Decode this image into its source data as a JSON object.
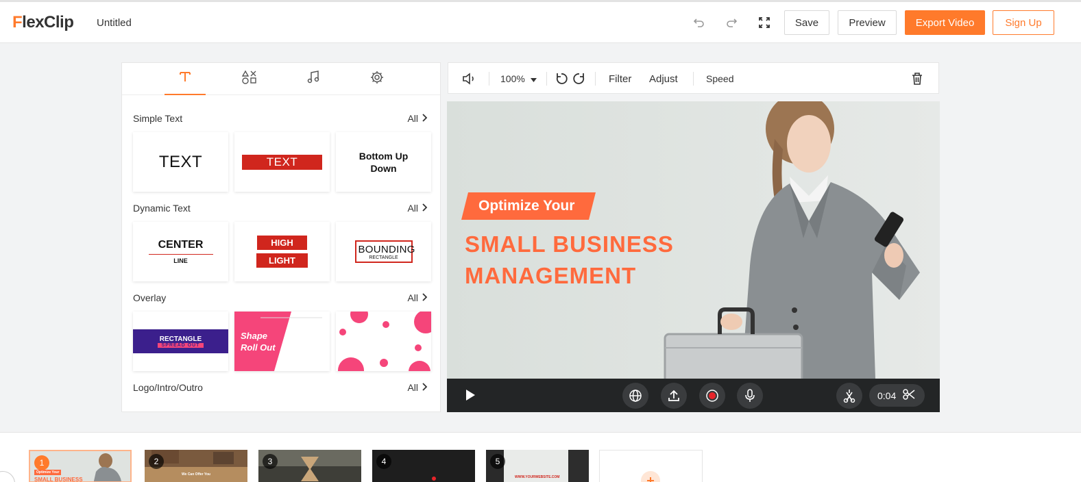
{
  "header": {
    "logo": "FlexClip",
    "doc_title": "Untitled",
    "save_label": "Save",
    "preview_label": "Preview",
    "export_label": "Export Video",
    "signup_label": "Sign Up"
  },
  "panel": {
    "sections": [
      {
        "title": "Simple Text",
        "all": "All"
      },
      {
        "title": "Dynamic Text",
        "all": "All"
      },
      {
        "title": "Overlay",
        "all": "All"
      },
      {
        "title": "Logo/Intro/Outro",
        "all": "All"
      }
    ],
    "cards": {
      "text_plain": "TEXT",
      "text_boxed": "TEXT",
      "bottom_up": "Bottom Up Down",
      "center": "CENTER",
      "line": "LINE",
      "high": "HIGH",
      "light": "LIGHT",
      "bounding": "BOUNDING",
      "rectangle_small": "RECTANGLE",
      "rectangle": "RECTANGLE",
      "spread_out": "SPREAD OUT",
      "shape": "Shape",
      "roll_out": "Roll Out"
    }
  },
  "toolbar": {
    "zoom": "100%",
    "filter": "Filter",
    "adjust": "Adjust",
    "speed": "Speed"
  },
  "preview": {
    "tag": "Optimize Your",
    "headline_1": "SMALL BUSINESS",
    "headline_2": "MANAGEMENT"
  },
  "player": {
    "time": "0:04"
  },
  "timeline": {
    "scenes": [
      "1",
      "2",
      "3",
      "4",
      "5"
    ],
    "thumb_1_tag": "Optimize Your",
    "thumb_1_title": "SMALL BUSINESS",
    "thumb_2_text": "We Can Offer You",
    "thumb_5_text": "WWW.YOURWEBSITE.COM"
  },
  "colors": {
    "accent": "#ff7a2b",
    "headline": "#ff6a3d",
    "red": "#d0261d",
    "purple": "#3b1f8c",
    "pink": "#f5457a"
  }
}
